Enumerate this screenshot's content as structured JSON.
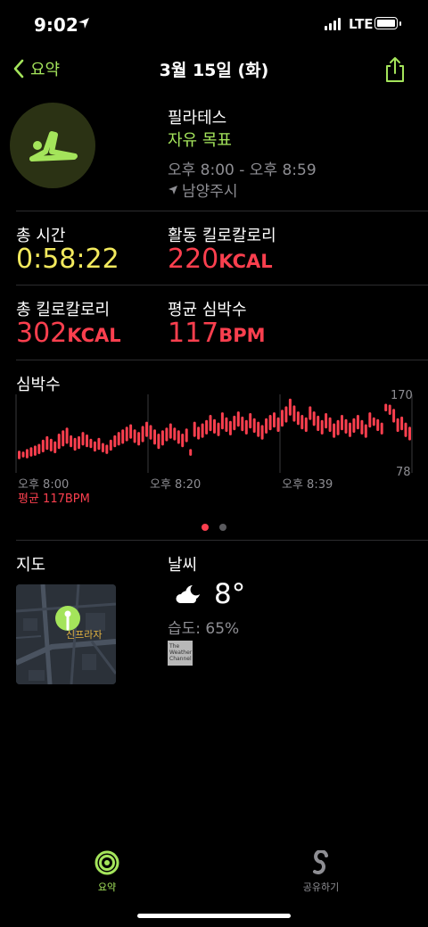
{
  "status_bar": {
    "time": "9:02",
    "network": "LTE"
  },
  "nav": {
    "back_label": "요약",
    "title": "3월 15일 (화)"
  },
  "workout": {
    "name": "필라테스",
    "goal": "자유 목표",
    "time_range": "오후 8:00 - 오후 8:59",
    "location": "남양주시"
  },
  "stats": {
    "total_time_label": "총 시간",
    "total_time_value": "0:58:22",
    "active_kcal_label": "활동 킬로칼로리",
    "active_kcal_value": "220",
    "active_kcal_unit": "KCAL",
    "total_kcal_label": "총 킬로칼로리",
    "total_kcal_value": "302",
    "total_kcal_unit": "KCAL",
    "avg_hr_label": "평균 심박수",
    "avg_hr_value": "117",
    "avg_hr_unit": "BPM"
  },
  "heart_rate": {
    "label": "심박수",
    "max_label": "170",
    "min_label": "78",
    "x_labels": [
      "오후 8:00",
      "오후 8:20",
      "오후 8:39"
    ],
    "avg_text": "평균 117BPM",
    "color": "#fa3f4e"
  },
  "chart_data": {
    "type": "bar",
    "title": "심박수",
    "ylim": [
      78,
      170
    ],
    "x_ticks": [
      "오후 8:00",
      "오후 8:20",
      "오후 8:39"
    ],
    "bars": [
      [
        94,
        104
      ],
      [
        96,
        103
      ],
      [
        95,
        106
      ],
      [
        97,
        108
      ],
      [
        98,
        110
      ],
      [
        100,
        112
      ],
      [
        102,
        117
      ],
      [
        105,
        121
      ],
      [
        103,
        118
      ],
      [
        101,
        115
      ],
      [
        106,
        124
      ],
      [
        109,
        128
      ],
      [
        112,
        131
      ],
      [
        108,
        122
      ],
      [
        104,
        119
      ],
      [
        106,
        121
      ],
      [
        110,
        126
      ],
      [
        108,
        123
      ],
      [
        107,
        118
      ],
      [
        103,
        115
      ],
      [
        105,
        119
      ],
      [
        102,
        113
      ],
      [
        100,
        111
      ],
      [
        104,
        117
      ],
      [
        108,
        122
      ],
      [
        110,
        126
      ],
      [
        112,
        129
      ],
      [
        115,
        132
      ],
      [
        118,
        135
      ],
      [
        113,
        129
      ],
      [
        110,
        126
      ],
      [
        114,
        133
      ],
      [
        120,
        138
      ],
      [
        117,
        134
      ],
      [
        111,
        129
      ],
      [
        106,
        124
      ],
      [
        110,
        128
      ],
      [
        115,
        131
      ],
      [
        118,
        136
      ],
      [
        116,
        131
      ],
      [
        112,
        128
      ],
      [
        108,
        124
      ],
      [
        114,
        130
      ],
      [
        98,
        106
      ],
      [
        120,
        138
      ],
      [
        117,
        132
      ],
      [
        119,
        136
      ],
      [
        123,
        140
      ],
      [
        127,
        146
      ],
      [
        124,
        141
      ],
      [
        121,
        137
      ],
      [
        129,
        149
      ],
      [
        126,
        143
      ],
      [
        122,
        139
      ],
      [
        128,
        145
      ],
      [
        132,
        150
      ],
      [
        127,
        144
      ],
      [
        123,
        140
      ],
      [
        130,
        148
      ],
      [
        125,
        142
      ],
      [
        120,
        138
      ],
      [
        117,
        134
      ],
      [
        124,
        142
      ],
      [
        128,
        146
      ],
      [
        131,
        149
      ],
      [
        126,
        143
      ],
      [
        132,
        152
      ],
      [
        137,
        156
      ],
      [
        145,
        165
      ],
      [
        138,
        157
      ],
      [
        134,
        150
      ],
      [
        129,
        146
      ],
      [
        126,
        143
      ],
      [
        140,
        156
      ],
      [
        133,
        150
      ],
      [
        127,
        145
      ],
      [
        123,
        140
      ],
      [
        130,
        148
      ],
      [
        126,
        143
      ],
      [
        119,
        136
      ],
      [
        122,
        140
      ],
      [
        128,
        146
      ],
      [
        124,
        141
      ],
      [
        120,
        137
      ],
      [
        125,
        142
      ],
      [
        129,
        146
      ],
      [
        123,
        140
      ],
      [
        119,
        135
      ],
      [
        131,
        149
      ],
      [
        133,
        143
      ],
      [
        127,
        141
      ],
      [
        123,
        137
      ],
      [
        150,
        159
      ],
      [
        146,
        158
      ],
      [
        137,
        153
      ],
      [
        126,
        142
      ],
      [
        128,
        144
      ],
      [
        120,
        137
      ],
      [
        116,
        132
      ]
    ],
    "avg_label": "평균 117BPM"
  },
  "map": {
    "label": "지도",
    "place": "신프라자"
  },
  "weather": {
    "label": "날씨",
    "temp": "8°",
    "humidity": "습도: 65%",
    "provider": "The Weather Channel"
  },
  "tabs": [
    {
      "label": "요약",
      "active": true
    },
    {
      "label": "공유하기",
      "active": false
    }
  ],
  "colors": {
    "accent_green": "#a4e45b",
    "yellow": "#f2e95d",
    "red": "#fa3f4e",
    "gray": "#8e8e93"
  }
}
